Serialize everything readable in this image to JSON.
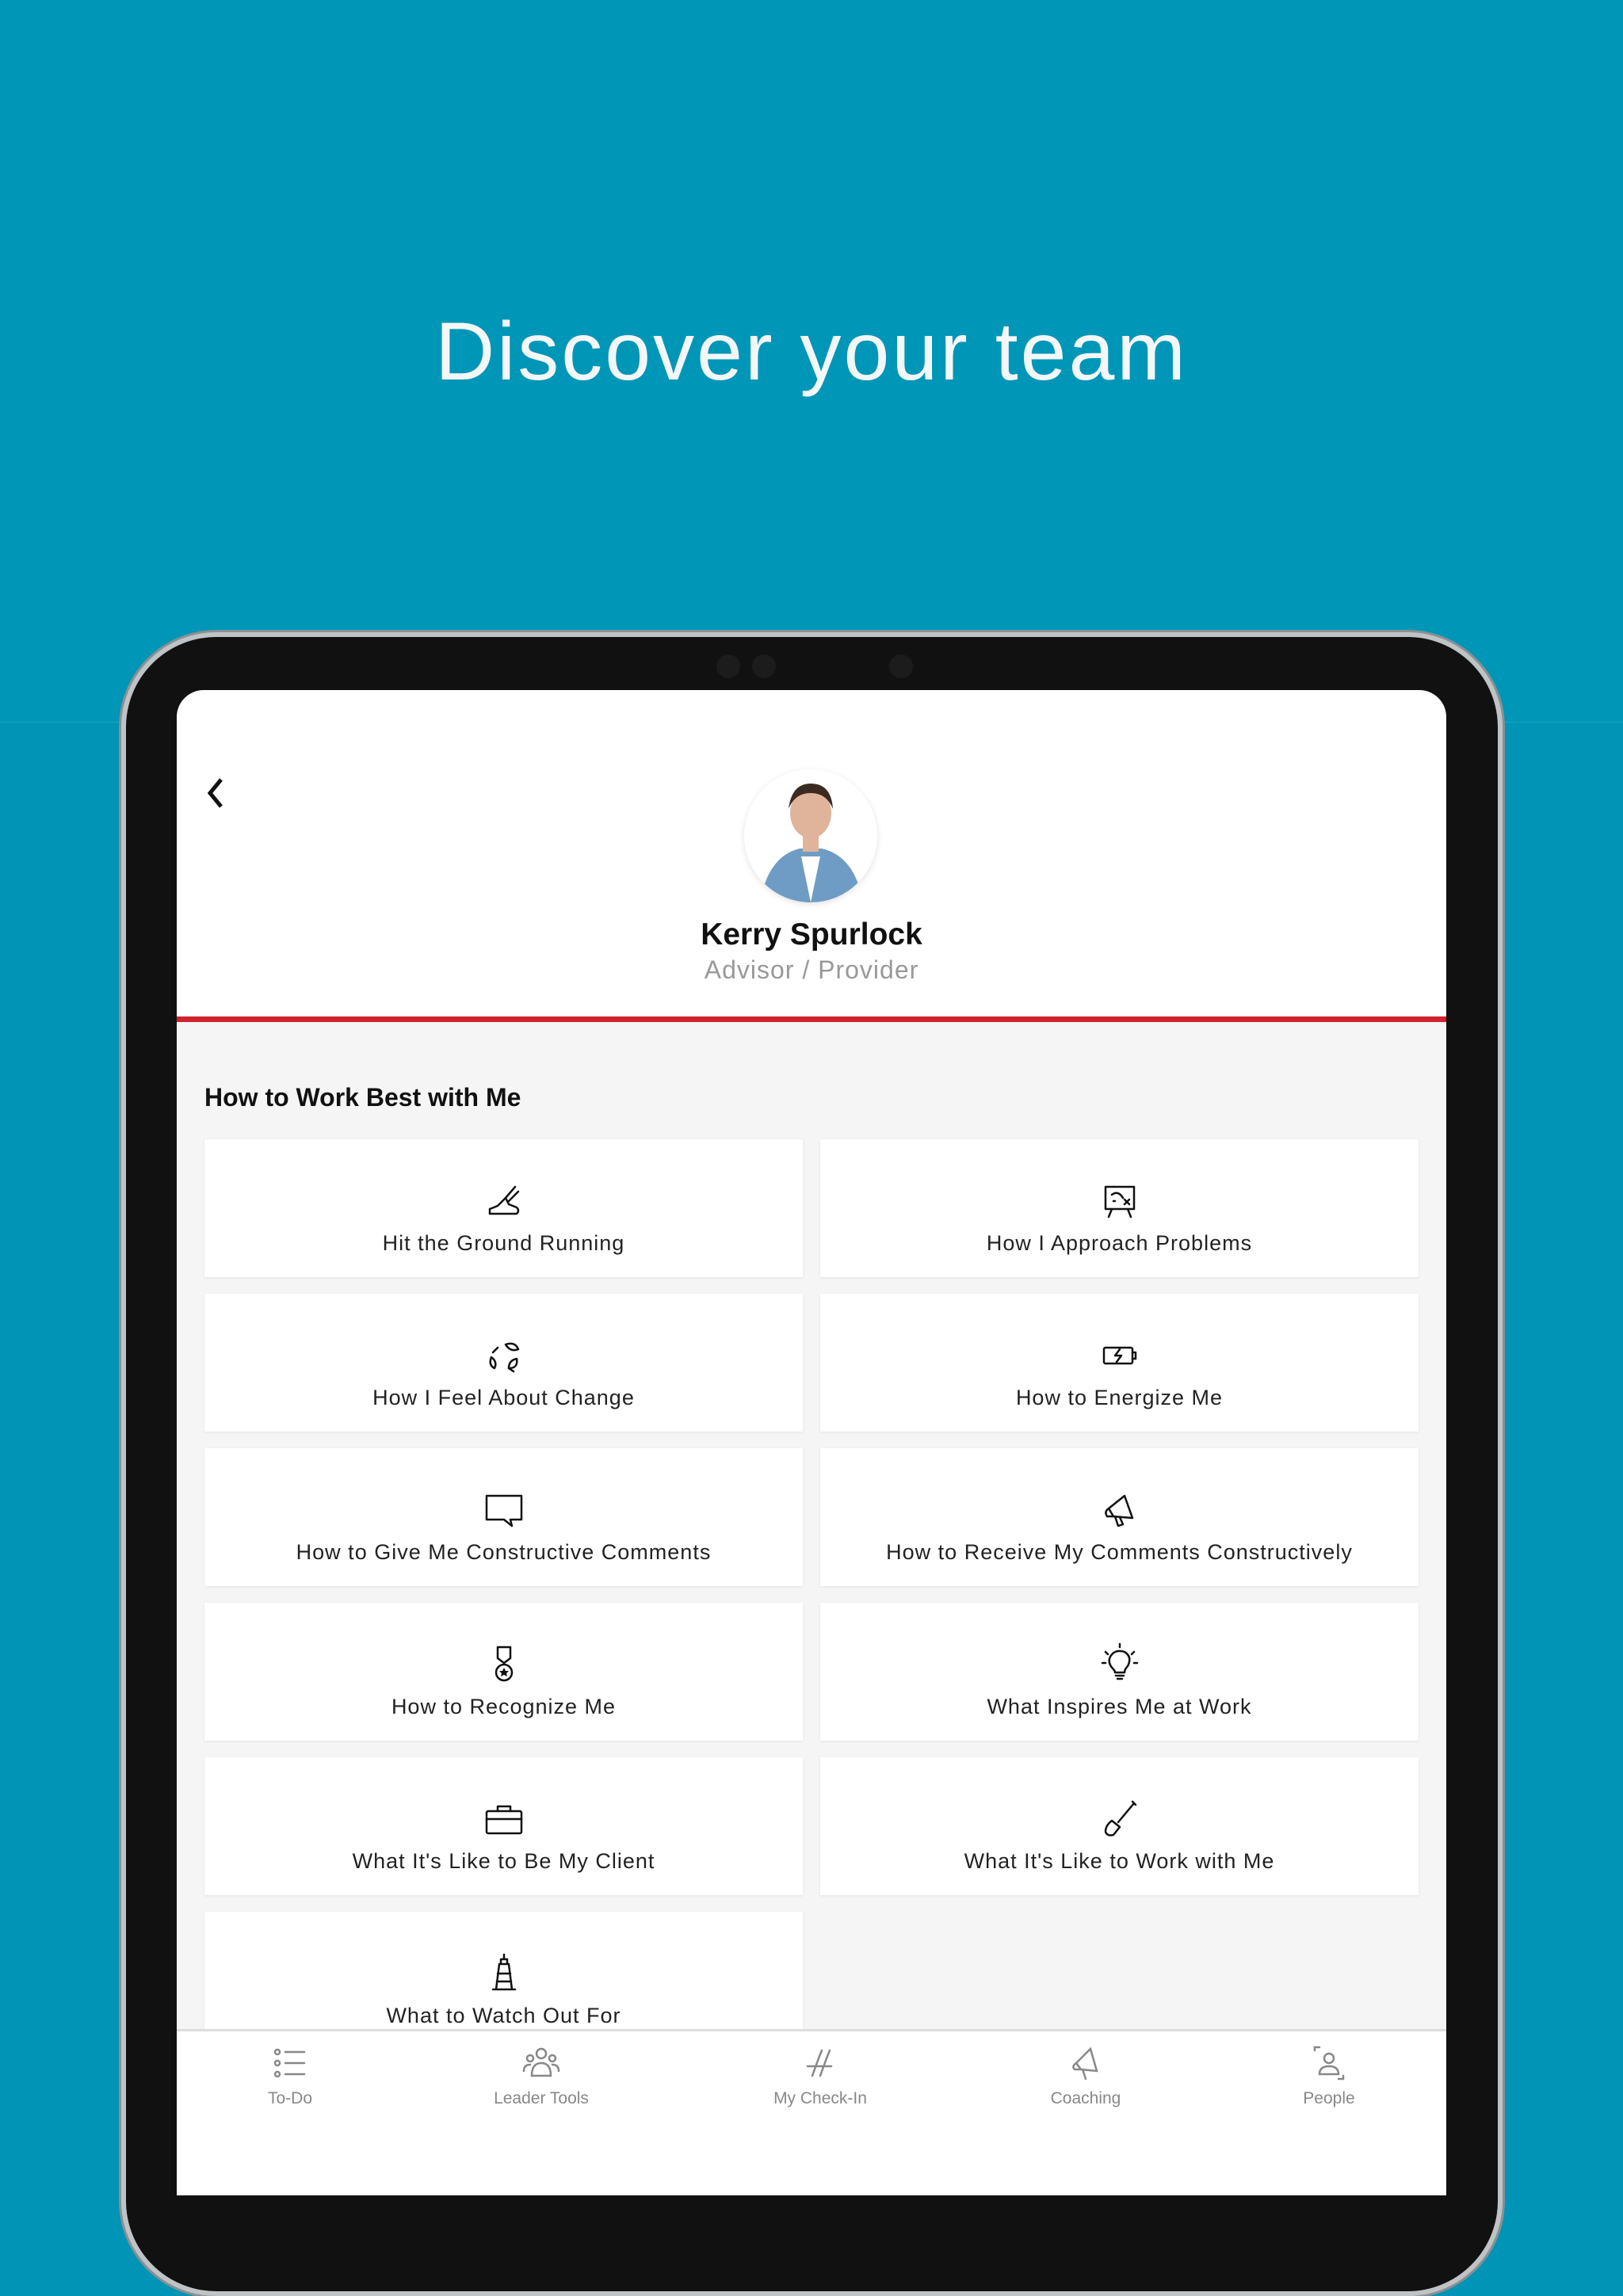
{
  "hero": {
    "title": "Discover your team"
  },
  "profile": {
    "name": "Kerry Spurlock",
    "role": "Advisor / Provider"
  },
  "section": {
    "title": "How to Work Best with Me"
  },
  "cards": [
    {
      "label": "Hit the Ground Running",
      "icon": "running-shoe-icon"
    },
    {
      "label": "How I Approach Problems",
      "icon": "strategy-board-icon"
    },
    {
      "label": "How I Feel About Change",
      "icon": "recycle-leaves-icon"
    },
    {
      "label": "How to Energize Me",
      "icon": "battery-charging-icon"
    },
    {
      "label": "How to Give Me Constructive Comments",
      "icon": "speech-bubble-icon"
    },
    {
      "label": "How to Receive My Comments Constructively",
      "icon": "megaphone-icon"
    },
    {
      "label": "How to Recognize Me",
      "icon": "medal-icon"
    },
    {
      "label": "What Inspires Me at Work",
      "icon": "lightbulb-icon"
    },
    {
      "label": "What It's Like to Be My Client",
      "icon": "briefcase-icon"
    },
    {
      "label": "What It's Like to Work with Me",
      "icon": "shovel-icon"
    },
    {
      "label": "What to Watch Out For",
      "icon": "lighthouse-icon"
    }
  ],
  "tabs": [
    {
      "label": "To-Do",
      "icon": "list-icon"
    },
    {
      "label": "Leader Tools",
      "icon": "group-icon"
    },
    {
      "label": "My Check-In",
      "icon": "chairs-icon"
    },
    {
      "label": "Coaching",
      "icon": "megaphone-icon"
    },
    {
      "label": "People",
      "icon": "person-frame-icon"
    }
  ],
  "colors": {
    "background": "#0096b8",
    "accent": "#d0222c"
  }
}
